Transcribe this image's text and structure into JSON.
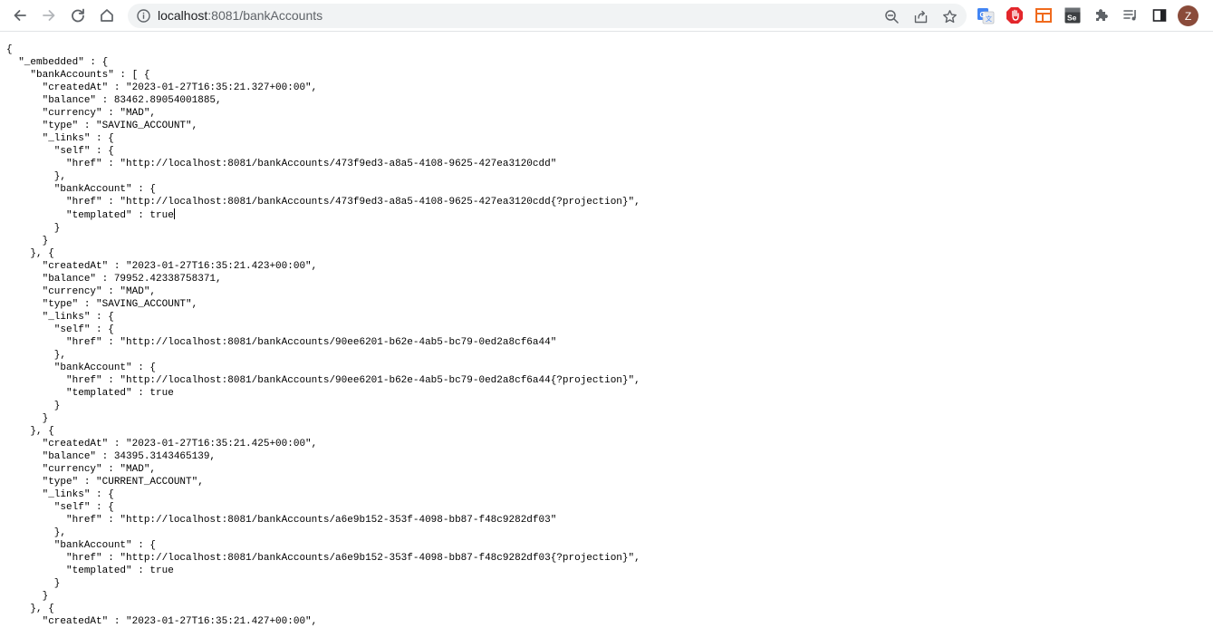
{
  "browser": {
    "url_host": "localhost",
    "url_path": ":8081/bankAccounts",
    "profile_initial": "Z"
  },
  "json_view": {
    "lines": [
      "{",
      "  \"_embedded\" : {",
      "    \"bankAccounts\" : [ {",
      "      \"createdAt\" : \"2023-01-27T16:35:21.327+00:00\",",
      "      \"balance\" : 83462.89054001885,",
      "      \"currency\" : \"MAD\",",
      "      \"type\" : \"SAVING_ACCOUNT\",",
      "      \"_links\" : {",
      "        \"self\" : {",
      "          \"href\" : \"http://localhost:8081/bankAccounts/473f9ed3-a8a5-4108-9625-427ea3120cdd\"",
      "        },",
      "        \"bankAccount\" : {",
      "          \"href\" : \"http://localhost:8081/bankAccounts/473f9ed3-a8a5-4108-9625-427ea3120cdd{?projection}\",",
      "          \"templated\" : true",
      "        }",
      "      }",
      "    }, {",
      "      \"createdAt\" : \"2023-01-27T16:35:21.423+00:00\",",
      "      \"balance\" : 79952.42338758371,",
      "      \"currency\" : \"MAD\",",
      "      \"type\" : \"SAVING_ACCOUNT\",",
      "      \"_links\" : {",
      "        \"self\" : {",
      "          \"href\" : \"http://localhost:8081/bankAccounts/90ee6201-b62e-4ab5-bc79-0ed2a8cf6a44\"",
      "        },",
      "        \"bankAccount\" : {",
      "          \"href\" : \"http://localhost:8081/bankAccounts/90ee6201-b62e-4ab5-bc79-0ed2a8cf6a44{?projection}\",",
      "          \"templated\" : true",
      "        }",
      "      }",
      "    }, {",
      "      \"createdAt\" : \"2023-01-27T16:35:21.425+00:00\",",
      "      \"balance\" : 34395.3143465139,",
      "      \"currency\" : \"MAD\",",
      "      \"type\" : \"CURRENT_ACCOUNT\",",
      "      \"_links\" : {",
      "        \"self\" : {",
      "          \"href\" : \"http://localhost:8081/bankAccounts/a6e9b152-353f-4098-bb87-f48c9282df03\"",
      "        },",
      "        \"bankAccount\" : {",
      "          \"href\" : \"http://localhost:8081/bankAccounts/a6e9b152-353f-4098-bb87-f48c9282df03{?projection}\",",
      "          \"templated\" : true",
      "        }",
      "      }",
      "    }, {",
      "      \"createdAt\" : \"2023-01-27T16:35:21.427+00:00\","
    ]
  }
}
